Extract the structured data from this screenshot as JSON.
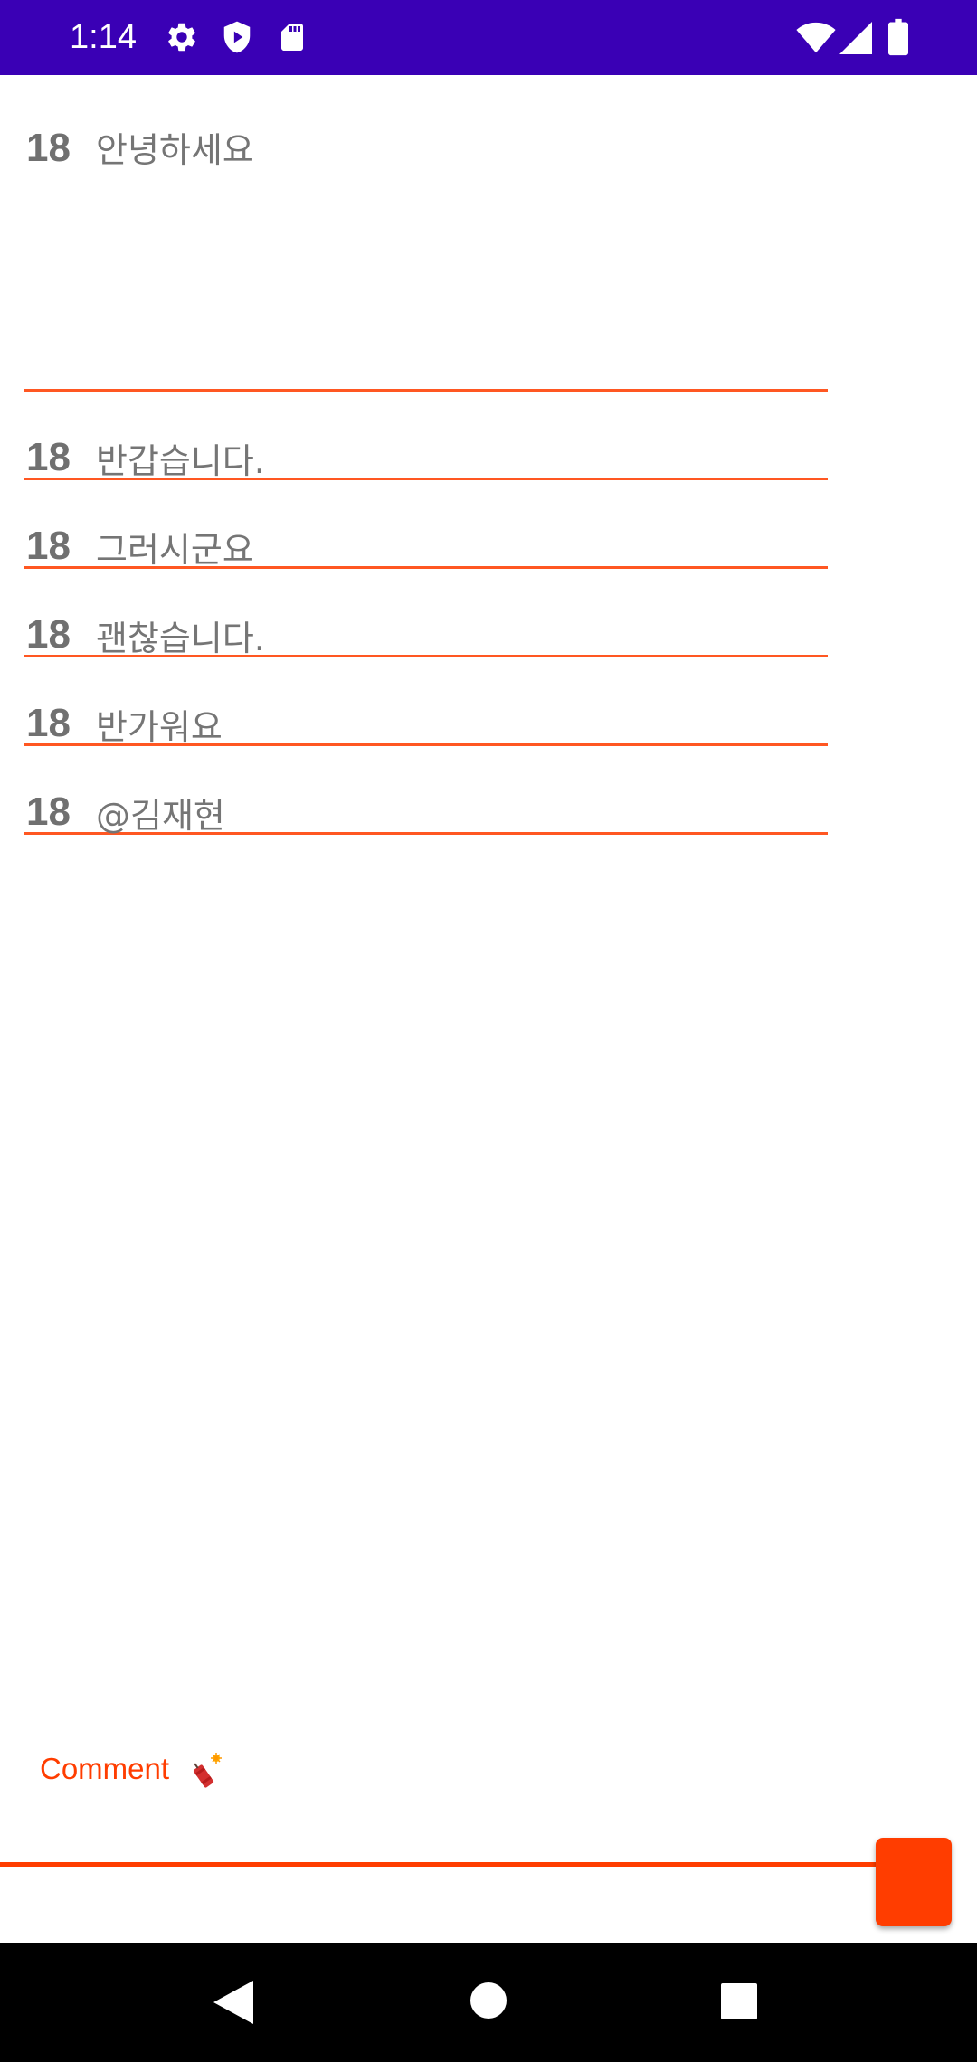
{
  "status_bar": {
    "time": "1:14",
    "icons_left": [
      "gear-icon",
      "shield-play-icon",
      "sd-card-icon"
    ],
    "icons_right": [
      "wifi-icon",
      "signal-icon",
      "battery-icon"
    ],
    "background": "#3A00B5"
  },
  "rows": [
    {
      "count": "18",
      "text": "안녕하세요"
    },
    {
      "count": "18",
      "text": "반갑습니다."
    },
    {
      "count": "18",
      "text": "그러시군요"
    },
    {
      "count": "18",
      "text": "괜찮습니다."
    },
    {
      "count": "18",
      "text": "반가워요"
    },
    {
      "count": "18",
      "text": "@김재현"
    }
  ],
  "comment": {
    "placeholder": "Comment",
    "icon": "firecracker-icon",
    "accent": "#FF3D00"
  },
  "nav_bar": {
    "icons": [
      "back-icon",
      "home-icon",
      "recents-icon"
    ]
  }
}
